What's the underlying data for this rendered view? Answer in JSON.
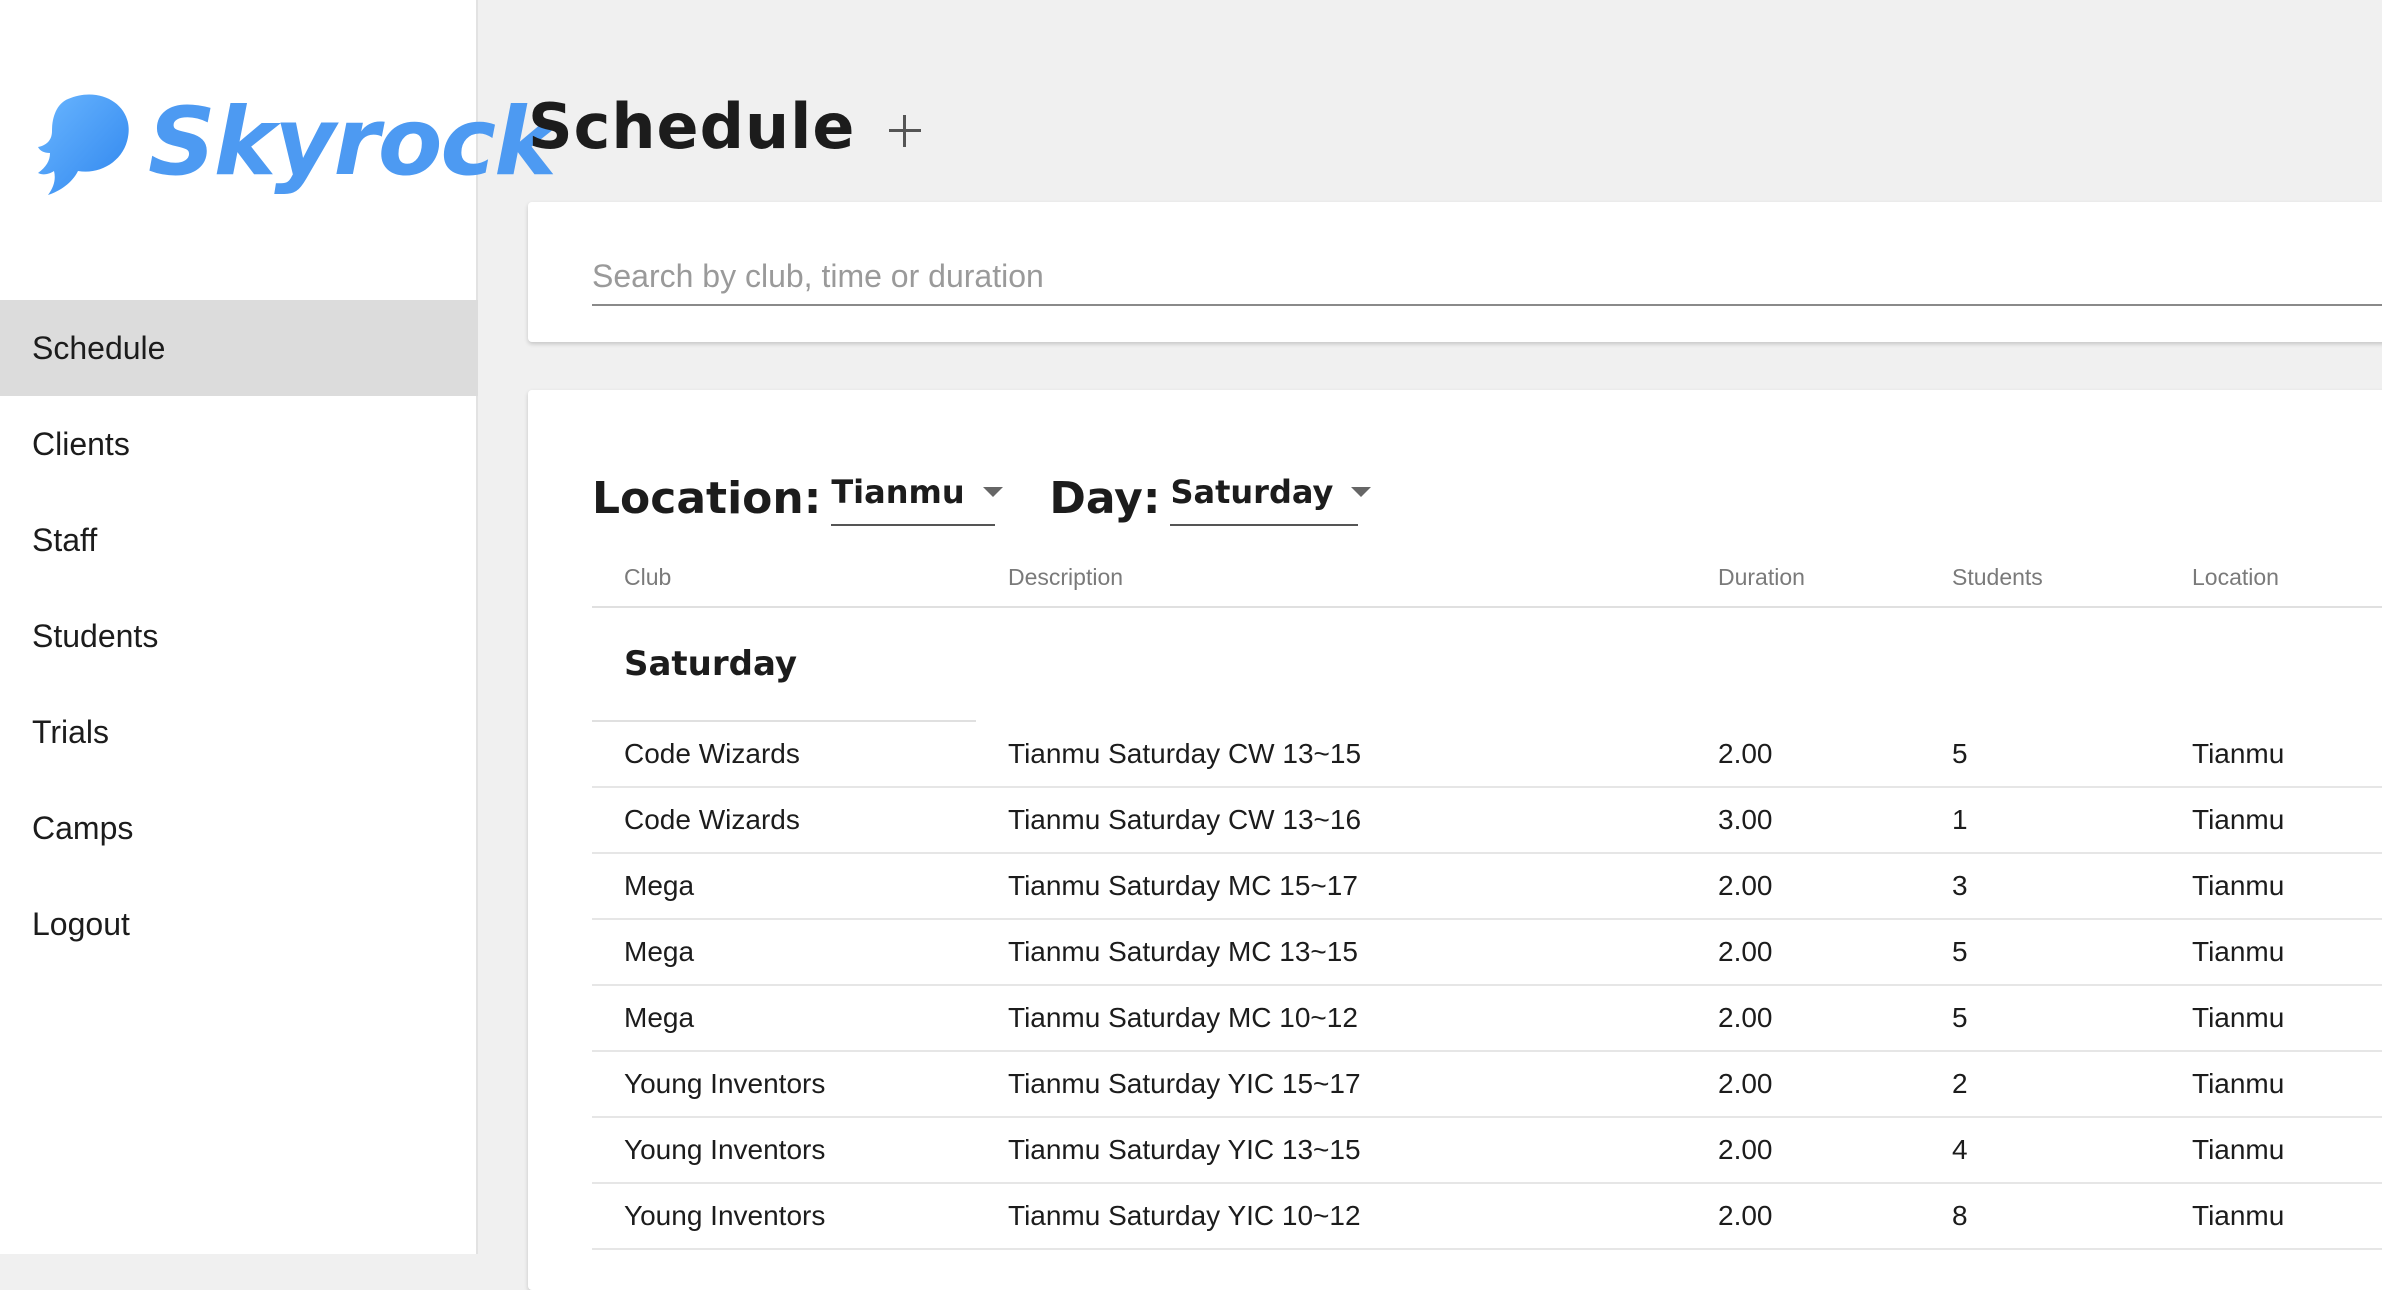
{
  "brand": {
    "name": "Skyrock",
    "color": "#4d9af2",
    "icon": "flame-logo-icon"
  },
  "sidebar": {
    "items": [
      {
        "label": "Schedule",
        "active": true
      },
      {
        "label": "Clients",
        "active": false
      },
      {
        "label": "Staff",
        "active": false
      },
      {
        "label": "Students",
        "active": false
      },
      {
        "label": "Trials",
        "active": false
      },
      {
        "label": "Camps",
        "active": false
      },
      {
        "label": "Logout",
        "active": false
      }
    ]
  },
  "header": {
    "title": "Schedule",
    "add_icon": "plus-icon"
  },
  "search": {
    "placeholder": "Search by club, time or duration",
    "value": ""
  },
  "filters": {
    "location": {
      "label": "Location:",
      "value": "Tianmu"
    },
    "day": {
      "label": "Day:",
      "value": "Saturday"
    }
  },
  "table": {
    "columns": {
      "club": "Club",
      "description": "Description",
      "duration": "Duration",
      "students": "Students",
      "location": "Location"
    },
    "group": "Saturday",
    "rows": [
      {
        "club": "Code Wizards",
        "description": "Tianmu Saturday CW 13~15",
        "duration": "2.00",
        "students": "5",
        "location": "Tianmu"
      },
      {
        "club": "Code Wizards",
        "description": "Tianmu Saturday CW 13~16",
        "duration": "3.00",
        "students": "1",
        "location": "Tianmu"
      },
      {
        "club": "Mega",
        "description": "Tianmu Saturday MC 15~17",
        "duration": "2.00",
        "students": "3",
        "location": "Tianmu"
      },
      {
        "club": "Mega",
        "description": "Tianmu Saturday MC 13~15",
        "duration": "2.00",
        "students": "5",
        "location": "Tianmu"
      },
      {
        "club": "Mega",
        "description": "Tianmu Saturday MC 10~12",
        "duration": "2.00",
        "students": "5",
        "location": "Tianmu"
      },
      {
        "club": "Young Inventors",
        "description": "Tianmu Saturday YIC 15~17",
        "duration": "2.00",
        "students": "2",
        "location": "Tianmu"
      },
      {
        "club": "Young Inventors",
        "description": "Tianmu Saturday YIC 13~15",
        "duration": "2.00",
        "students": "4",
        "location": "Tianmu"
      },
      {
        "club": "Young Inventors",
        "description": "Tianmu Saturday YIC 10~12",
        "duration": "2.00",
        "students": "8",
        "location": "Tianmu"
      }
    ]
  }
}
